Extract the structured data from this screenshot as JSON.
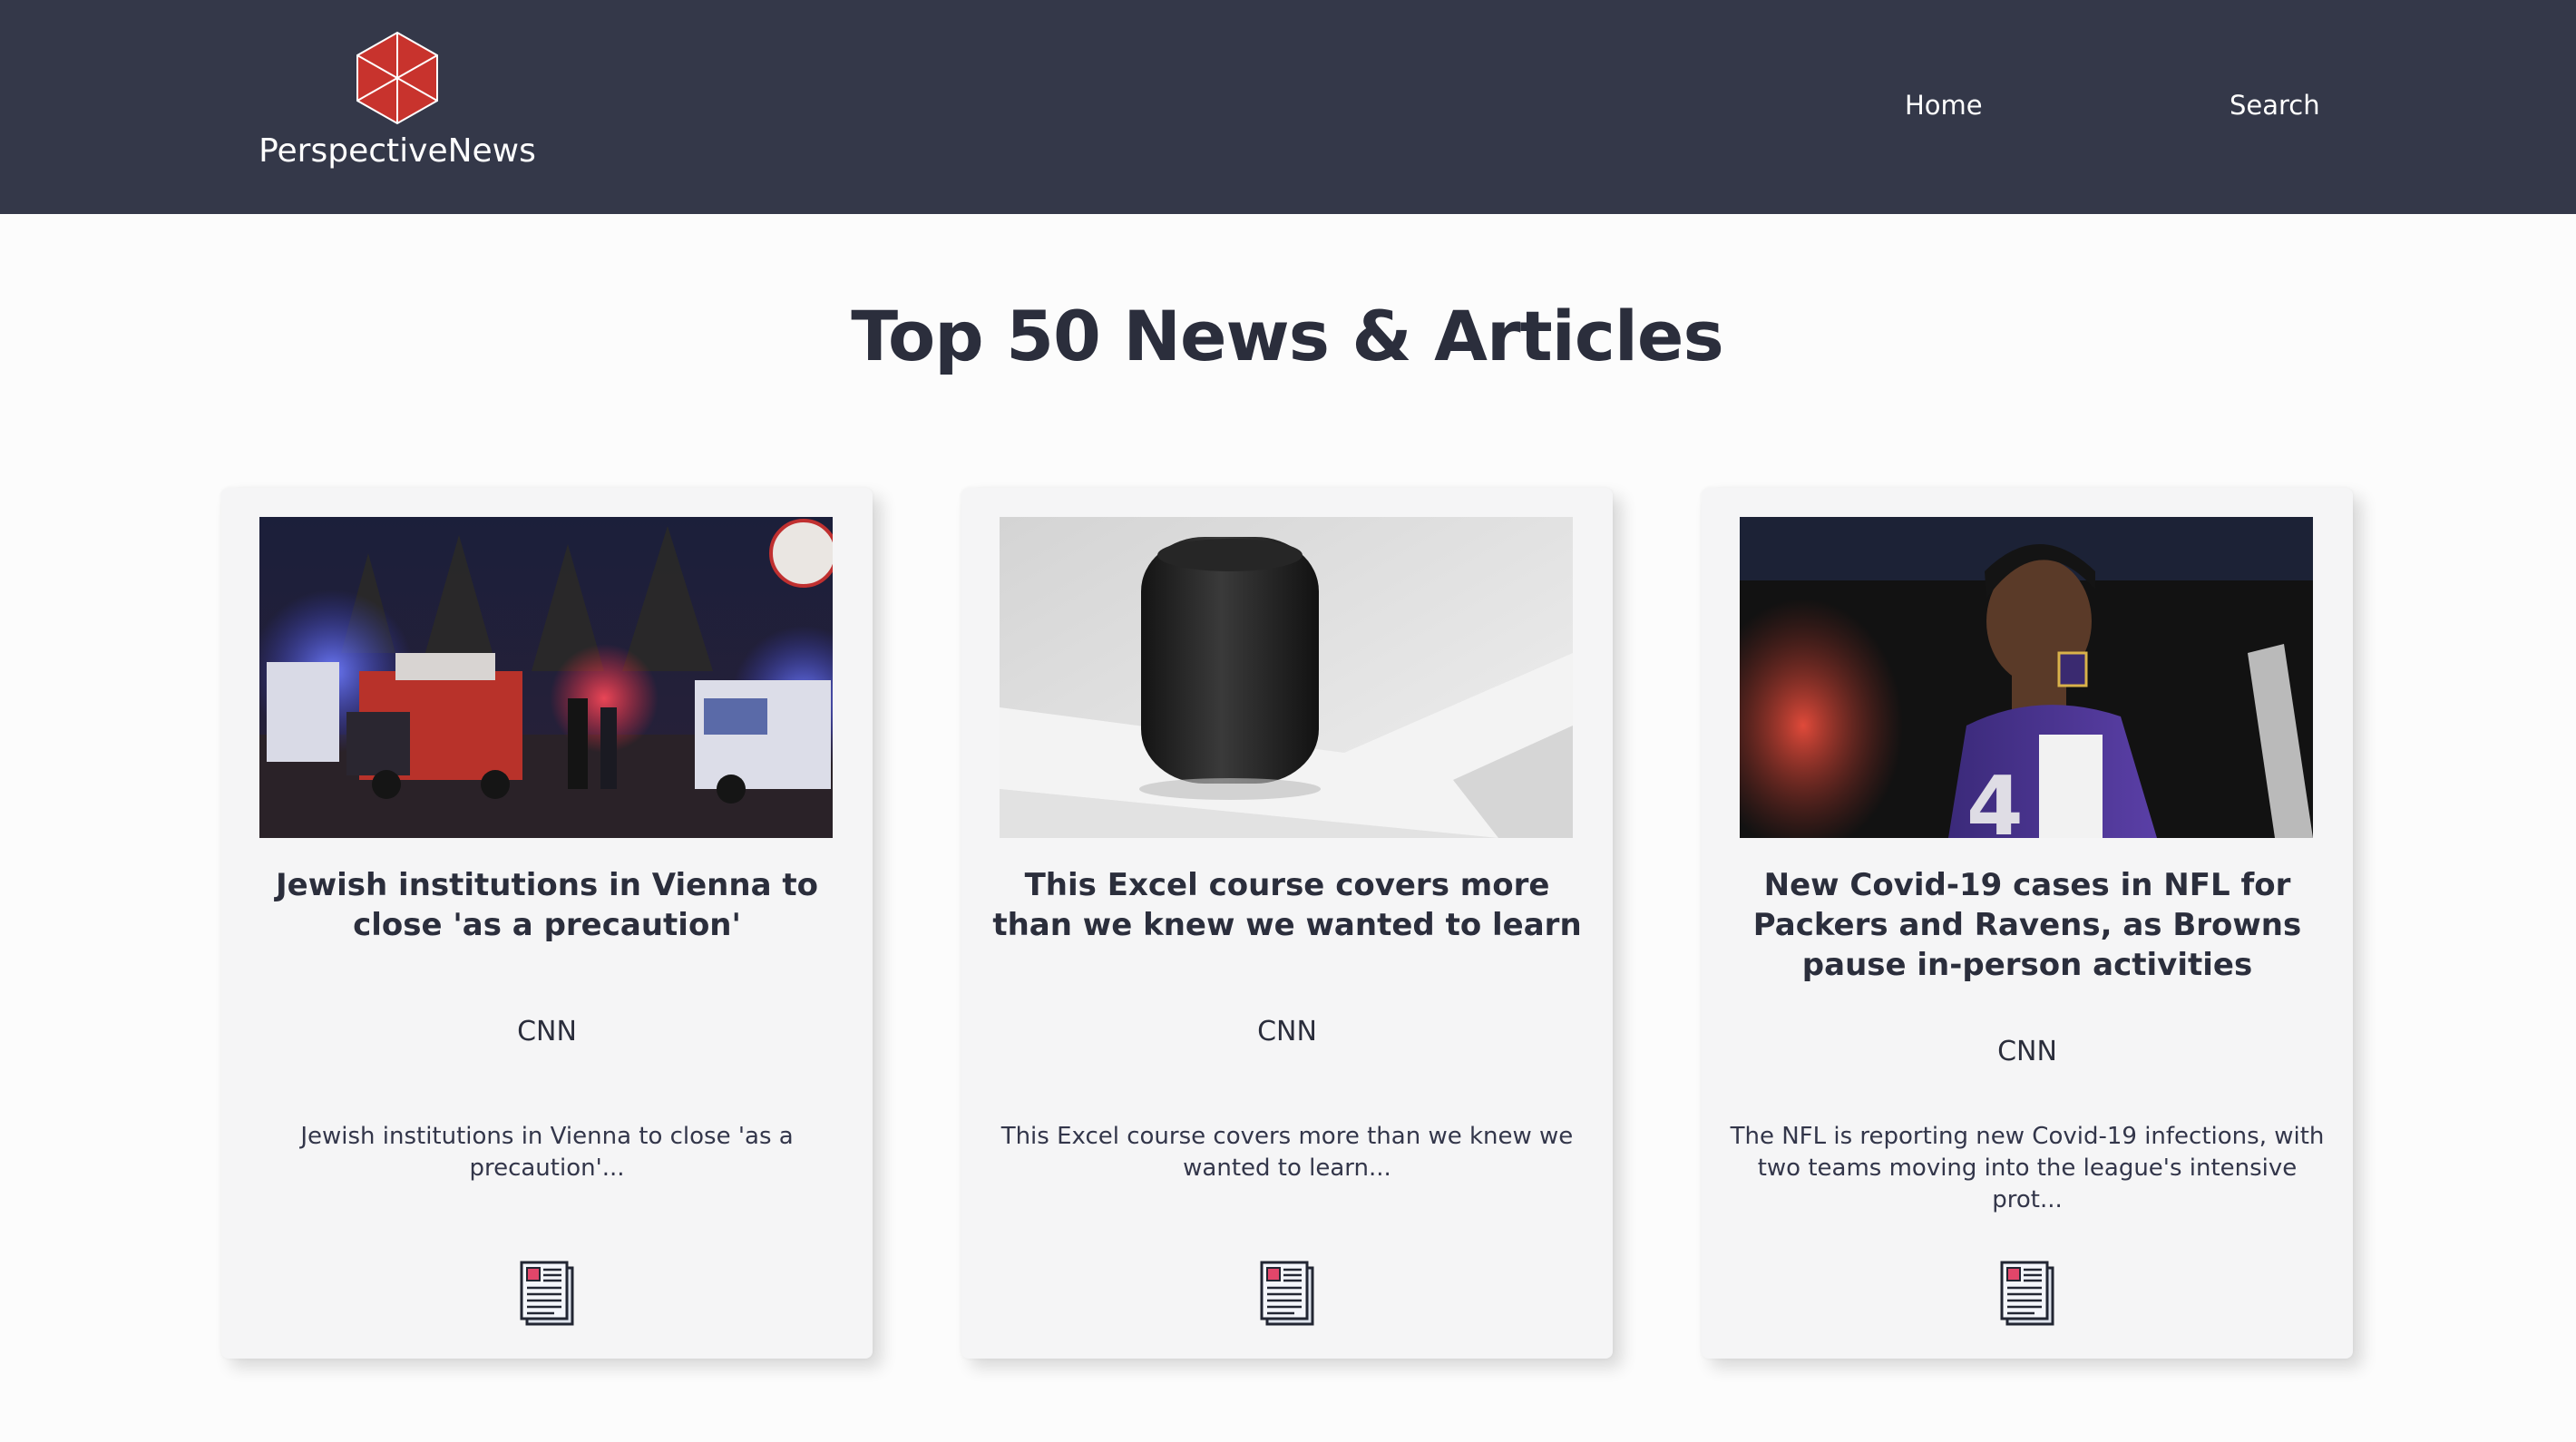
{
  "header": {
    "brand_name": "PerspectiveNews",
    "logo_icon": "red-cube-logo-icon",
    "nav": {
      "home": "Home",
      "search": "Search"
    }
  },
  "main": {
    "title": "Top 50 News & Articles"
  },
  "articles": [
    {
      "title": "Jewish institutions in Vienna to close 'as a precaution'",
      "source": "CNN",
      "description": "Jewish institutions in Vienna to close 'as a precaution'...",
      "image_icon": "vienna-police-street-photo",
      "link_icon": "newspaper-icon"
    },
    {
      "title": "This Excel course covers more than we knew we wanted to learn",
      "source": "CNN",
      "description": "This Excel course covers more than we knew we wanted to learn...",
      "image_icon": "smart-speaker-photo",
      "link_icon": "newspaper-icon"
    },
    {
      "title": "New Covid-19 cases in NFL for Packers and Ravens, as Browns pause in-person activities",
      "source": "CNN",
      "description": "The NFL is reporting new Covid-19 infections, with two teams moving into the league's intensive prot...",
      "image_icon": "football-player-photo",
      "link_icon": "newspaper-icon"
    }
  ],
  "colors": {
    "header_bg": "#343849",
    "page_bg": "#fcfcfc",
    "card_bg": "#f5f5f6",
    "text_dark": "#2b2e3c",
    "logo_red": "#c8332d"
  }
}
